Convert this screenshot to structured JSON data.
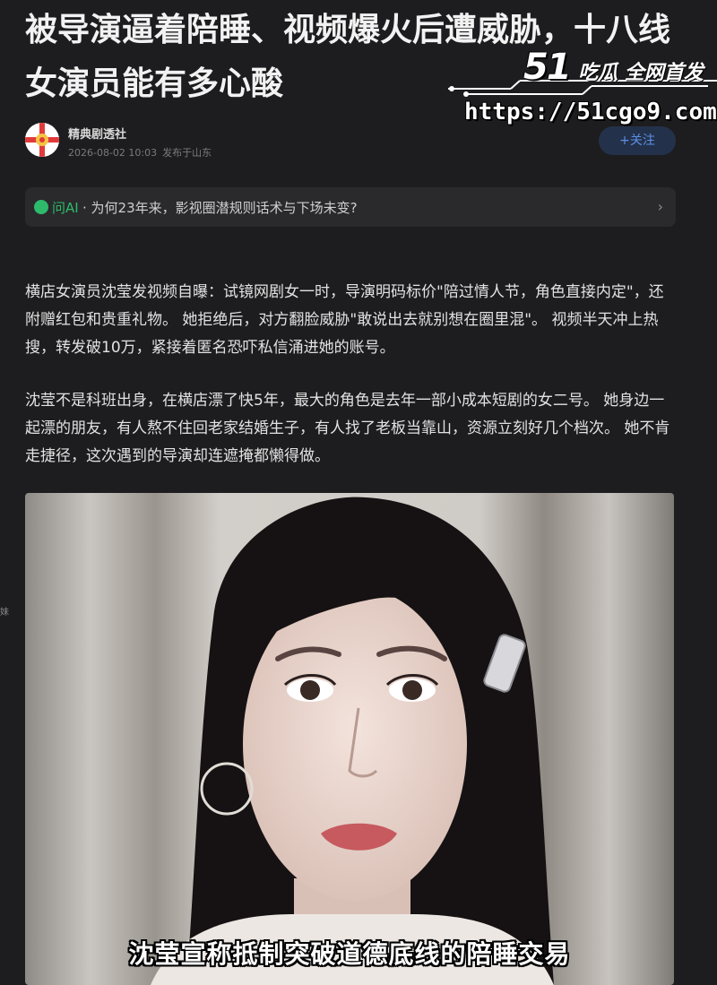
{
  "article": {
    "title": "被导演逼着陪睡、视频爆火后遭威胁，十八线女演员能有多心酸"
  },
  "watermark": {
    "brand_number": "51",
    "brand_text": "吃瓜 全网首发",
    "url": "https://51cgo9.com"
  },
  "author": {
    "name": "精典剧透社",
    "date": "2026-08-02 10:03",
    "location": "发布于山东",
    "follow_label": "+关注"
  },
  "ai_bar": {
    "label": "问AI",
    "question": "· 为何23年来，影视圈潜规则话术与下场未变?",
    "chevron": "›"
  },
  "body": {
    "paragraph1": "横店女演员沈莹发视频自曝：试镜网剧女一时，导演明码标价\"陪过情人节，角色直接内定\"，还附赠红包和贵重礼物。 她拒绝后，对方翻脸威胁\"敢说出去就别想在圈里混\"。 视频半天冲上热搜，转发破10万，紧接着匿名恐吓私信涌进她的账号。",
    "paragraph2": "沈莹不是科班出身，在横店漂了快5年，最大的角色是去年一部小成本短剧的女二号。 她身边一起漂的朋友，有人熬不住回老家结婚生子，有人找了老板当靠山，资源立刻好几个档次。 她不肯走捷径，这次遇到的导演却连遮掩都懒得做。"
  },
  "side_mark": "妹",
  "photo": {
    "caption": "沈莹宣称抵制突破道德底线的陪睡交易"
  },
  "colors": {
    "background": "#1d1d1f",
    "accent_green": "#2dbb6b",
    "follow_blue": "#5d8ee6"
  }
}
